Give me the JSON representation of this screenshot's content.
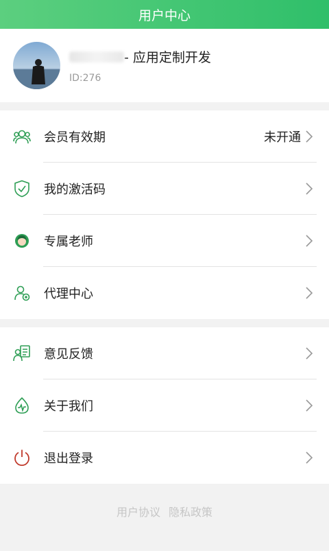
{
  "header": {
    "title": "用户中心"
  },
  "profile": {
    "name": "- 应用定制开发",
    "id": "ID:276"
  },
  "menu_group_1": [
    {
      "label": "会员有效期",
      "value": "未开通",
      "icon": "members-icon"
    },
    {
      "label": "我的激活码",
      "value": "",
      "icon": "shield-check-icon"
    },
    {
      "label": "专属老师",
      "value": "",
      "icon": "teacher-icon"
    },
    {
      "label": "代理中心",
      "value": "",
      "icon": "agent-icon"
    }
  ],
  "menu_group_2": [
    {
      "label": "意见反馈",
      "value": "",
      "icon": "feedback-icon"
    },
    {
      "label": "关于我们",
      "value": "",
      "icon": "pulse-drop-icon"
    },
    {
      "label": "退出登录",
      "value": "",
      "icon": "power-icon"
    }
  ],
  "footer": {
    "user_agreement": "用户协议",
    "privacy_policy": "隐私政策"
  },
  "colors": {
    "brand_green": "#2fbf6a",
    "icon_green": "#2e9e55",
    "logout_red": "#c0392b"
  }
}
